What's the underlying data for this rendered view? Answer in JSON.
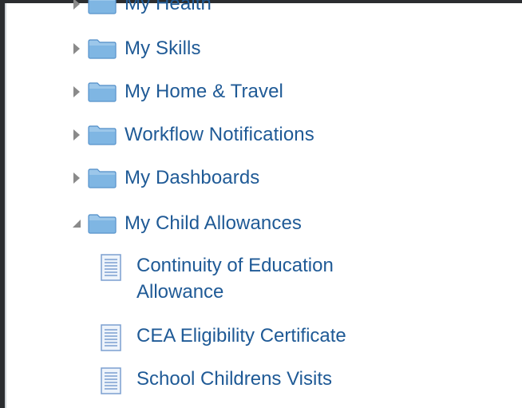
{
  "tree": {
    "folders": [
      {
        "label": "My Health",
        "state": "collapsed"
      },
      {
        "label": "My Skills",
        "state": "collapsed"
      },
      {
        "label": "My Home & Travel",
        "state": "collapsed"
      },
      {
        "label": "Workflow Notifications",
        "state": "collapsed"
      },
      {
        "label": "My Dashboards",
        "state": "collapsed"
      },
      {
        "label": "My Child Allowances",
        "state": "expanded"
      }
    ],
    "documents": [
      {
        "label": "Continuity of Education Allowance"
      },
      {
        "label": "CEA Eligibility Certificate"
      },
      {
        "label": "School Childrens Visits"
      }
    ]
  },
  "icons": {
    "collapsed_toggle": "triangle-right-icon",
    "expanded_toggle": "triangle-down-left-icon",
    "folder": "folder-icon",
    "document": "document-icon"
  },
  "colors": {
    "link": "#1f5a96",
    "folder_fill": "#7fb6e3",
    "folder_edge": "#4f8dc8",
    "toggle": "#8a8a8a"
  }
}
